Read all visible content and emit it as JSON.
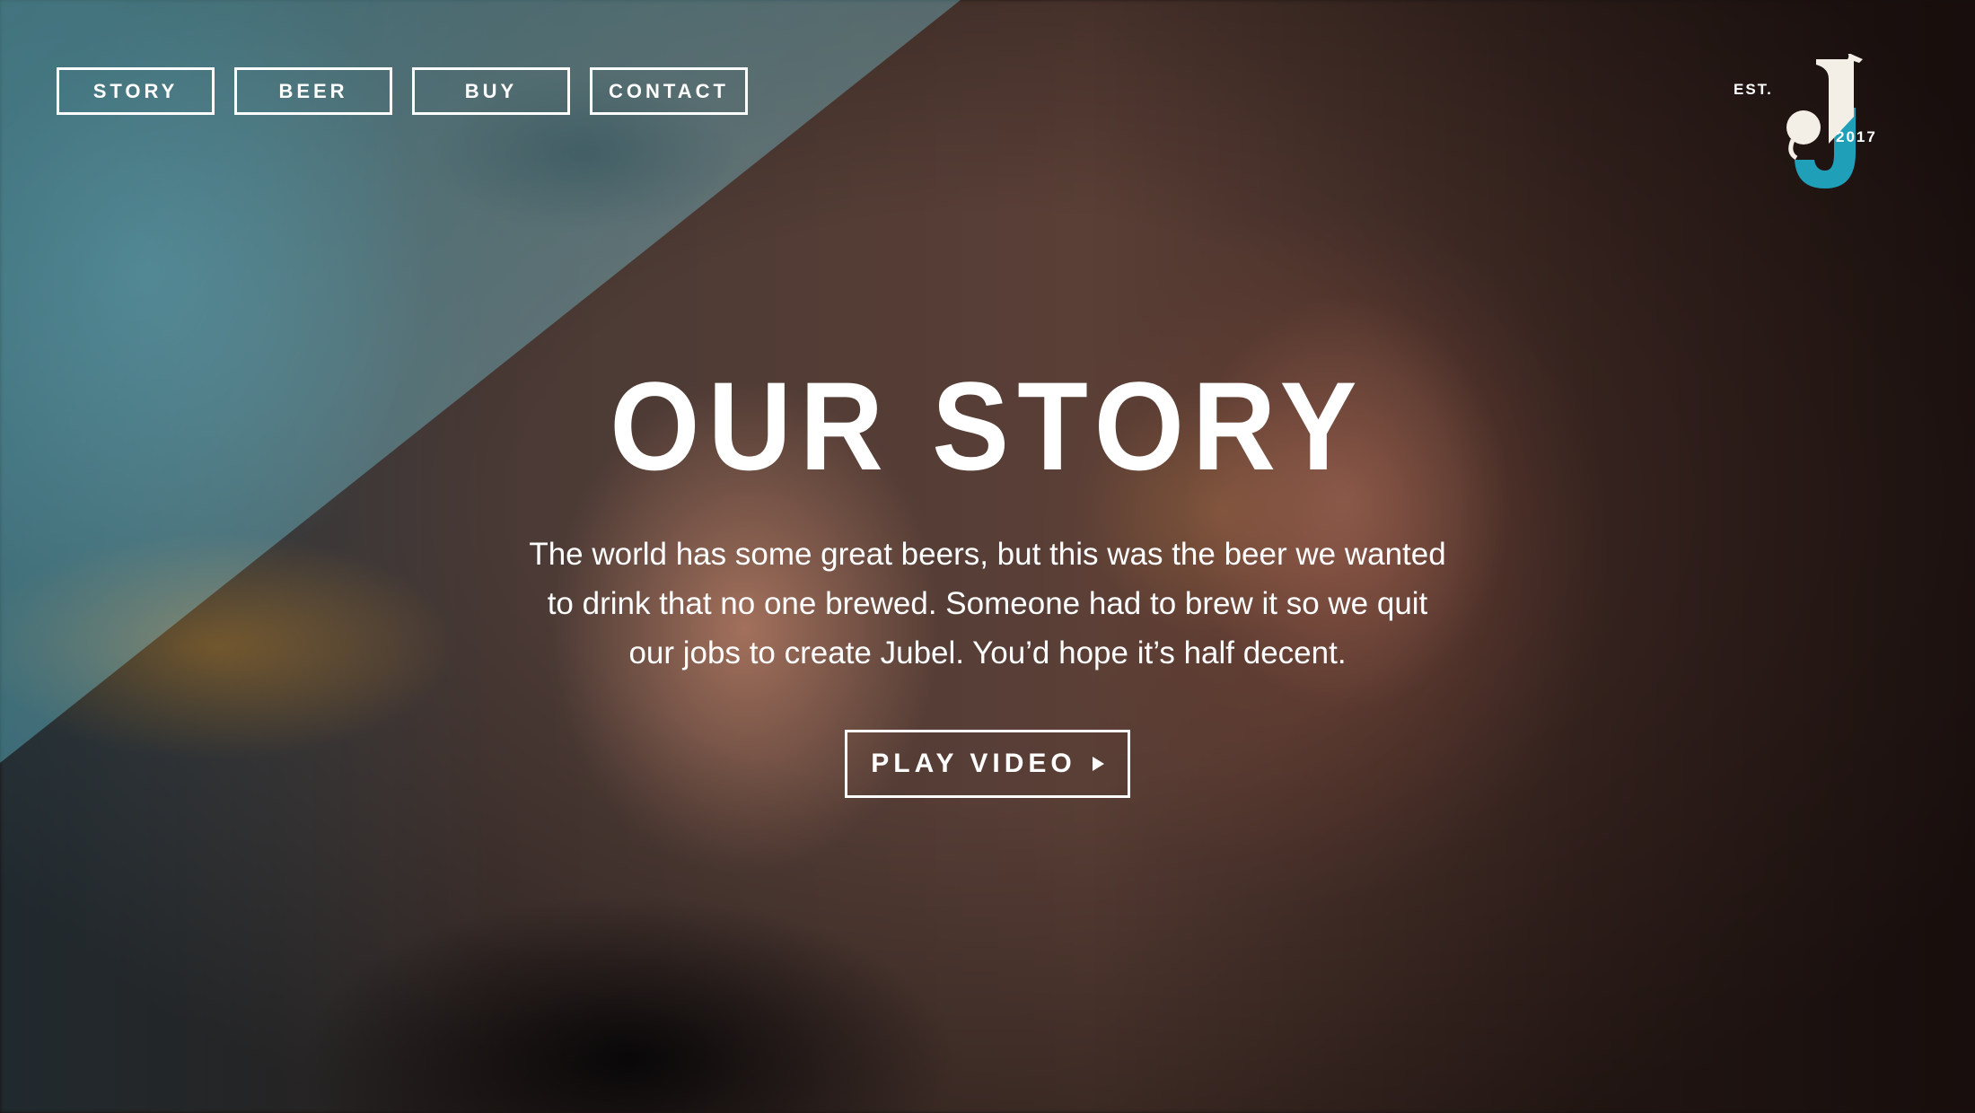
{
  "nav": {
    "items": [
      {
        "label": "STORY"
      },
      {
        "label": "BEER"
      },
      {
        "label": "BUY"
      },
      {
        "label": "CONTACT"
      }
    ]
  },
  "logo": {
    "est": "EST.",
    "year": "2017",
    "accent_color": "#1fa0b8",
    "cream_color": "#f3efe6"
  },
  "hero": {
    "title": "OUR STORY",
    "body": "The world has some great beers, but this was the beer we wanted to drink that no one brewed. Someone had to brew it so we quit our jobs to create Jubel. You’d hope it’s half decent.",
    "play_label": "PLAY VIDEO",
    "play_icon": "play-icon"
  },
  "colors": {
    "overlay_teal": "#46a0af",
    "text": "#ffffff"
  }
}
